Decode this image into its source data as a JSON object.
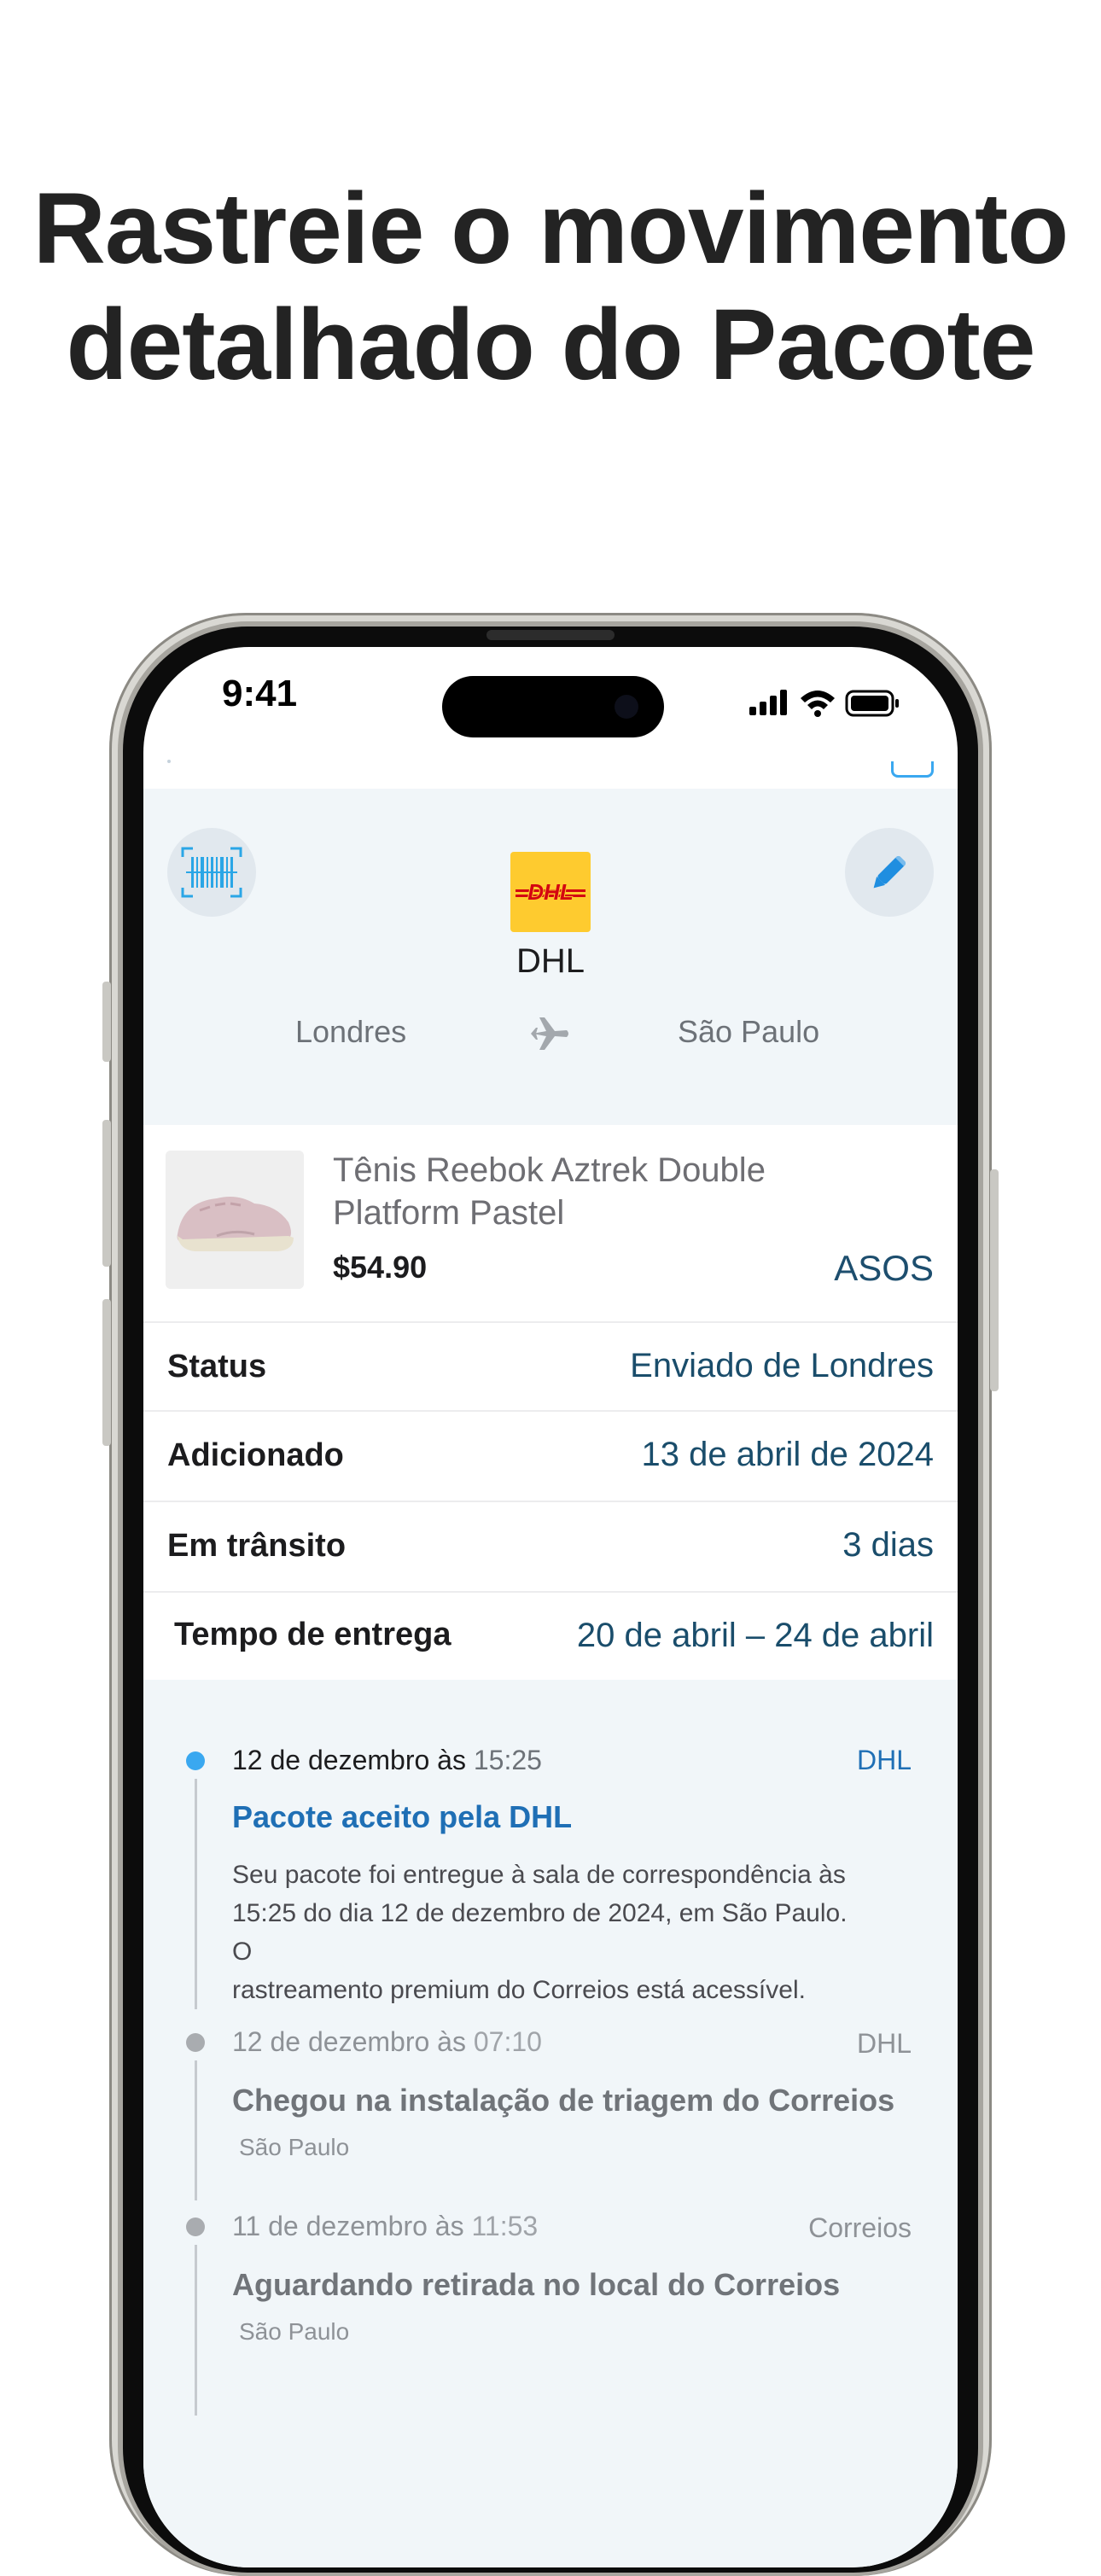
{
  "headline": {
    "line1": "Rastreie o movimento",
    "line2": "detalhado do Pacote"
  },
  "status_bar": {
    "time": "9:41"
  },
  "header": {
    "carrier_name": "DHL",
    "logo_text": "DHL",
    "logo_color": "#fecb2f",
    "logo_text_color": "#d40511",
    "origin": "Londres",
    "destination": "São Paulo",
    "scan_icon": "barcode-scan-icon",
    "edit_icon": "pencil-icon",
    "route_icon": "airplane-icon"
  },
  "product": {
    "title_line1": "Tênis Reebok Aztrek Double",
    "title_line2": "Platform Pastel",
    "price": "$54.90",
    "shop": "ASOS"
  },
  "details": [
    {
      "label": "Status",
      "value": "Enviado de Londres"
    },
    {
      "label": "Adicionado",
      "value": "13 de abril de 2024"
    },
    {
      "label": "Em trânsito",
      "value": "3 dias"
    },
    {
      "label": "Tempo de entrega",
      "value": "20 de abril – 24 de abril"
    }
  ],
  "timeline": [
    {
      "date": "12 de dezembro às",
      "time": "15:25",
      "carrier": "DHL",
      "title": "Pacote aceito pela DHL",
      "desc_line1": "Seu pacote foi entregue à sala de correspondência às",
      "desc_line2": "15:25 do dia 12 de dezembro de 2024, em São Paulo. O",
      "desc_line3": "rastreamento premium do Correios está acessível."
    },
    {
      "date": "12 de dezembro às",
      "time": "07:10",
      "carrier": "DHL",
      "title": "Chegou na instalação de triagem do Correios",
      "location": "São Paulo"
    },
    {
      "date": "11 de dezembro às",
      "time": "11:53",
      "carrier": "Correios",
      "title": "Aguardando retirada no local do Correios",
      "location": "São Paulo"
    }
  ],
  "colors": {
    "accent": "#1f6fb5",
    "active_dot": "#3aa8f0",
    "inactive_dot": "#a9acb0",
    "value_text": "#1a4d6b",
    "header_bg": "#f1f6f9"
  }
}
